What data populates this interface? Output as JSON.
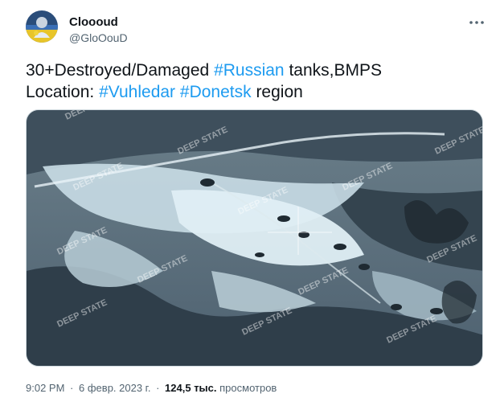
{
  "author": {
    "display_name": "Clooоud",
    "handle": "@GloOouD"
  },
  "tweet": {
    "line1_prefix": "30+Destroyed/Damaged ",
    "line1_tag": "#Russian",
    "line1_suffix": " tanks,BMPS",
    "line2_prefix": "Location: ",
    "line2_tag1": "#Vuhledar",
    "line2_space": " ",
    "line2_tag2": "#Donetsk",
    "line2_suffix": " region"
  },
  "media": {
    "watermark": "DEEP STATE"
  },
  "meta": {
    "time": "9:02 PM",
    "date": "6 февр. 2023 г.",
    "separator": "·",
    "views_count": "124,5 тыс.",
    "views_label": "просмотров"
  },
  "icons": {
    "more": "more-options-icon"
  },
  "colors": {
    "hashtag": "#1d9bf0",
    "text": "#0f1419",
    "secondary": "#536471"
  }
}
